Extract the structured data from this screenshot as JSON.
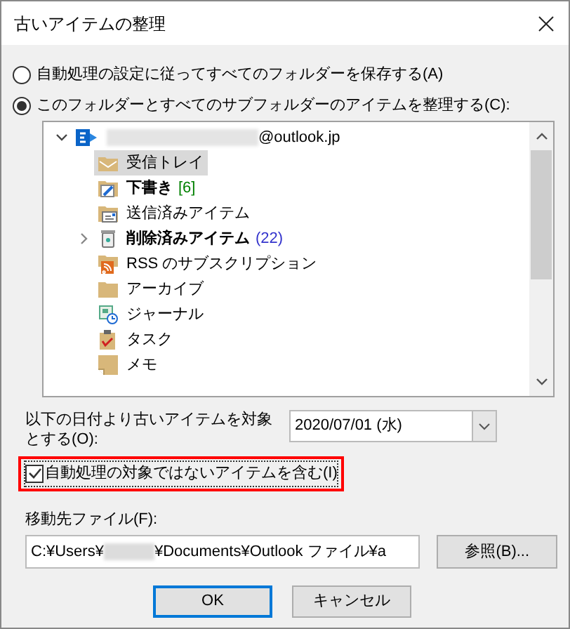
{
  "window": {
    "title": "古いアイテムの整理"
  },
  "options": [
    {
      "label": "自動処理の設定に従ってすべてのフォルダーを保存する(A)",
      "selected": false
    },
    {
      "label": "このフォルダーとすべてのサブフォルダーのアイテムを整理する(C):",
      "selected": true
    }
  ],
  "folder_tree": [
    {
      "label": "@outlook.jp",
      "kind": "account",
      "expanded": true,
      "redacted": true,
      "children": [
        {
          "label": "受信トレイ",
          "kind": "inbox",
          "selected": true
        },
        {
          "label": "下書き",
          "count": "[6]",
          "color": "#008000",
          "kind": "drafts",
          "bold": true,
          "selected": false
        },
        {
          "label": "送信済みアイテム",
          "kind": "sent",
          "selected": false
        },
        {
          "label": "削除済みアイテム",
          "count": "(22)",
          "color": "#3333cc",
          "kind": "trash",
          "bold": true,
          "expanded": false,
          "selected": false
        },
        {
          "label": "RSS のサブスクリプション",
          "kind": "rss",
          "selected": false
        },
        {
          "label": "アーカイブ",
          "kind": "folder",
          "selected": false
        },
        {
          "label": "ジャーナル",
          "kind": "journal",
          "selected": false
        },
        {
          "label": "タスク",
          "kind": "tasks",
          "selected": false
        },
        {
          "label": "メモ",
          "kind": "notes",
          "selected": false
        }
      ]
    }
  ],
  "date_filter": {
    "label": "以下の日付より古いアイテムを対象とする(O):",
    "value": "2020/07/01 (水)"
  },
  "include_excluded": {
    "label": "自動処理の対象ではないアイテムを含む(I)",
    "checked": true
  },
  "destination": {
    "label": "移動先ファイル(F):",
    "value_before": "C:¥Users¥",
    "value_after": "¥Documents¥Outlook ファイル¥a",
    "redacted": true,
    "browse_button": "参照(B)..."
  },
  "buttons": [
    {
      "label": "OK",
      "default": true
    },
    {
      "label": "キャンセル",
      "default": false
    }
  ]
}
